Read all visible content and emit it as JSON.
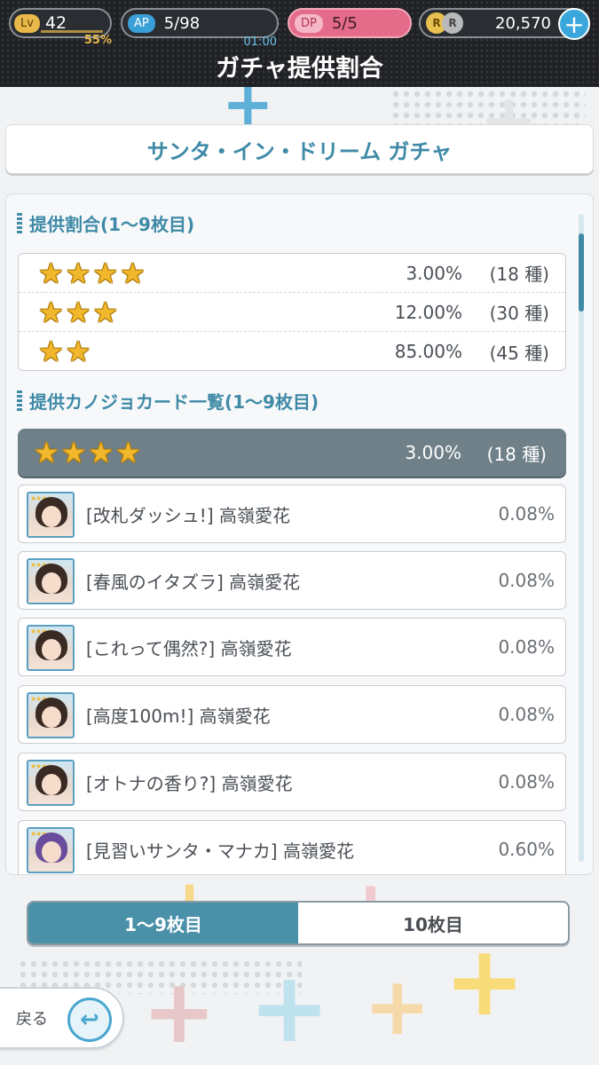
{
  "status": {
    "level_tag": "Lv",
    "level": "42",
    "level_progress": "55%",
    "ap_tag": "AP",
    "ap": "5/98",
    "ap_timer": "01:00",
    "dp_tag": "DP",
    "dp": "5/5",
    "coin_r1": "R",
    "coin_r2": "R",
    "coins": "20,570",
    "add_icon": "plus-icon"
  },
  "header": {
    "title": "ガチャ提供割合"
  },
  "gacha_name": "サンタ・イン・ドリーム ガチャ",
  "rates": {
    "heading": "提供割合(1〜9枚目)",
    "rows": [
      {
        "stars": 4,
        "rate": "3.00%",
        "count": "(18 種)"
      },
      {
        "stars": 3,
        "rate": "12.00%",
        "count": "(30 種)"
      },
      {
        "stars": 2,
        "rate": "85.00%",
        "count": "(45 種)"
      }
    ]
  },
  "card_list": {
    "heading": "提供カノジョカード一覧(1〜9枚目)",
    "tier": {
      "stars": 4,
      "rate": "3.00%",
      "count": "(18 種)"
    },
    "cards": [
      {
        "name": "[改札ダッシュ!] 高嶺愛花",
        "rate": "0.08%"
      },
      {
        "name": "[春風のイタズラ] 高嶺愛花",
        "rate": "0.08%"
      },
      {
        "name": "[これって偶然?] 高嶺愛花",
        "rate": "0.08%"
      },
      {
        "name": "[高度100m!] 高嶺愛花",
        "rate": "0.08%"
      },
      {
        "name": "[オトナの香り?] 高嶺愛花",
        "rate": "0.08%"
      },
      {
        "name": "[見習いサンタ・マナカ] 高嶺愛花",
        "rate": "0.60%"
      }
    ]
  },
  "tabs": [
    {
      "label": "1〜9枚目",
      "active": true
    },
    {
      "label": "10枚目",
      "active": false
    }
  ],
  "back": {
    "label": "戻る",
    "icon": "back-arrow-icon"
  },
  "colors": {
    "accent": "#3f8aa7",
    "star": "#f1b82d",
    "dp": "#e46c8a",
    "ap": "#3aa0d8",
    "tier_bg": "#6f8088"
  }
}
